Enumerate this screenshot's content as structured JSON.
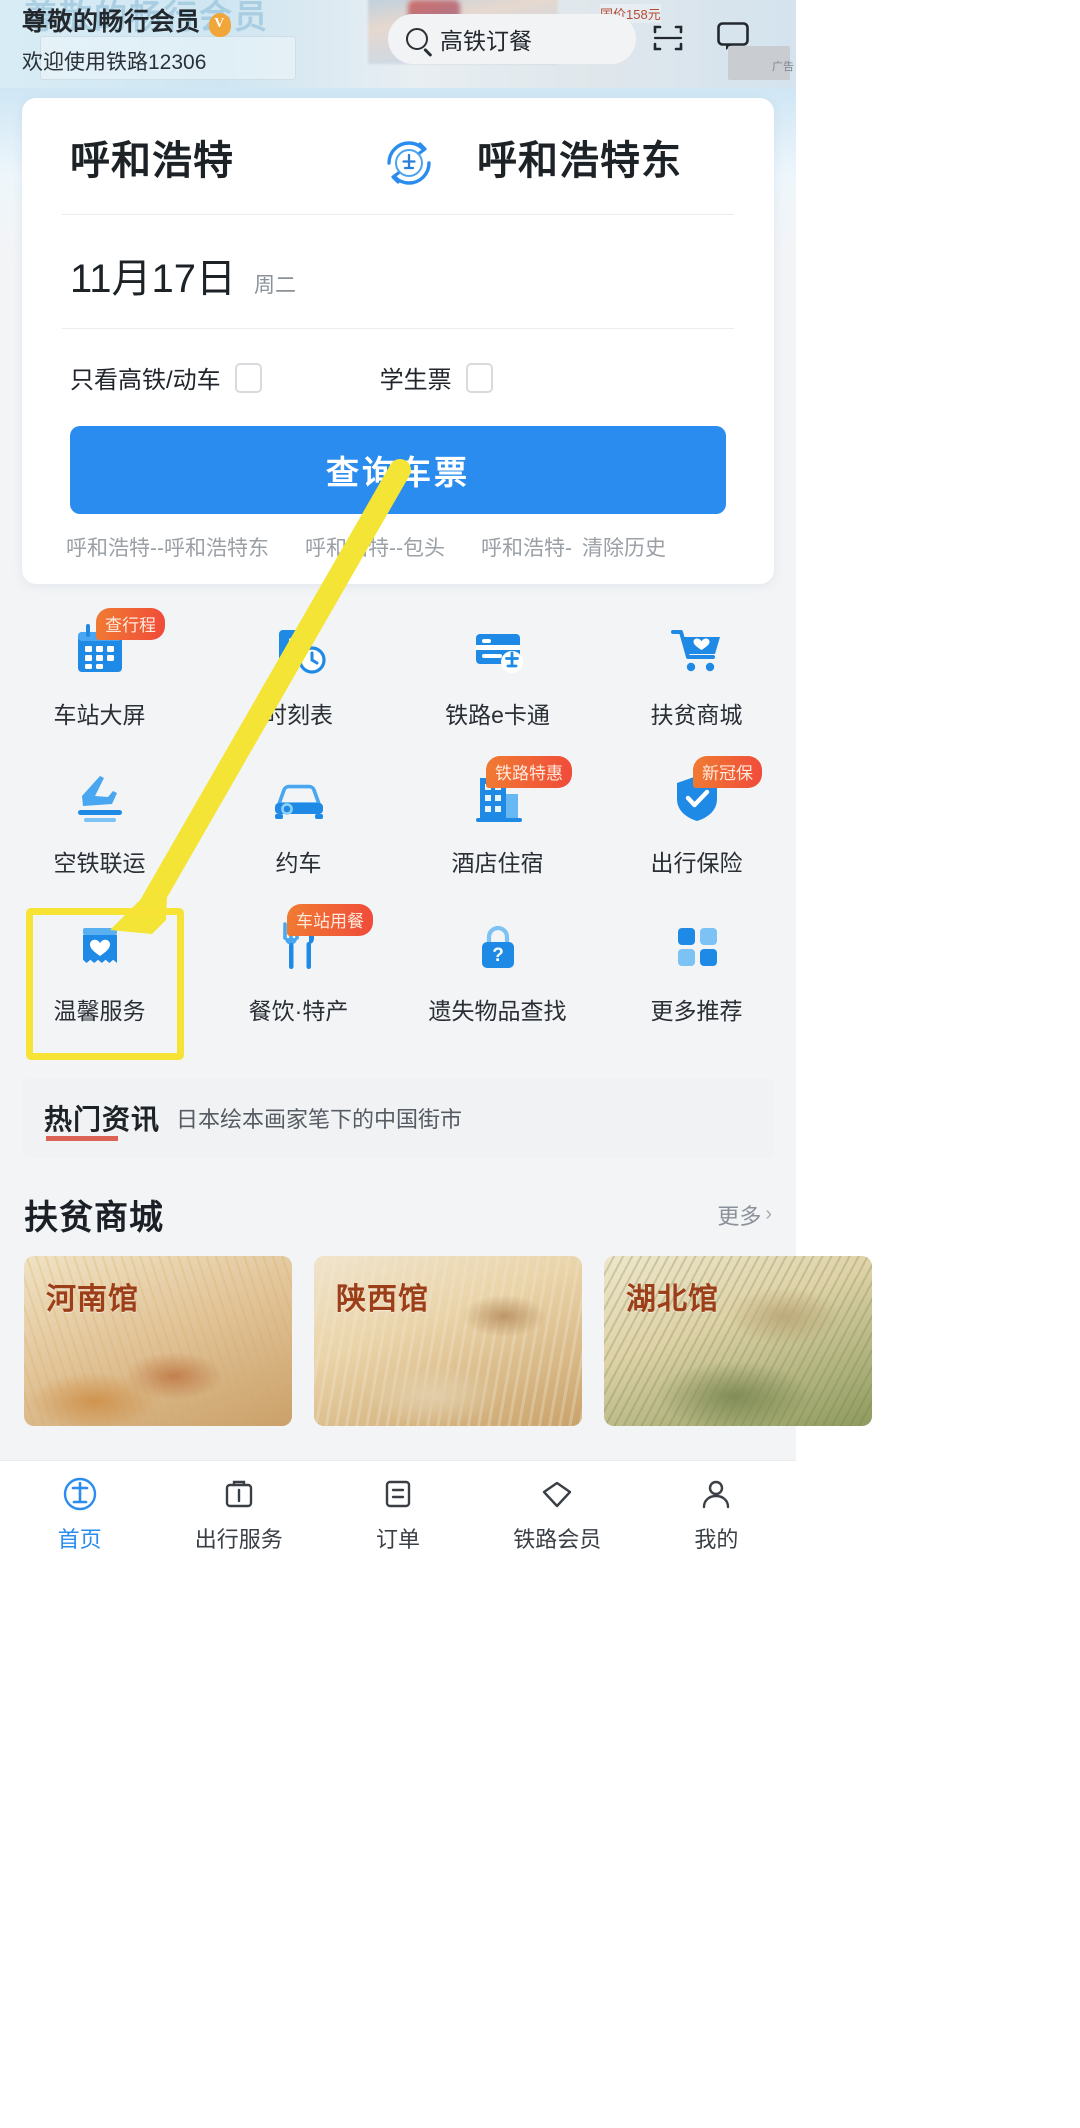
{
  "banner": {
    "ghost_text": "尊敬的畅行会员",
    "greeting": "尊敬的畅行会员",
    "vip_mark": "V",
    "subtitle": "欢迎使用铁路12306",
    "ad_price": "国价158元",
    "ad_label": "广告"
  },
  "search": {
    "placeholder": "高铁订餐",
    "icon": "search-icon",
    "scan_icon": "scan-icon",
    "message_icon": "message-icon"
  },
  "ticket_form": {
    "from_station": "呼和浩特",
    "to_station": "呼和浩特东",
    "swap_icon": "station-swap-icon",
    "date": "11月17日",
    "weekday": "周二",
    "options": [
      {
        "label": "只看高铁/动车",
        "checked": false
      },
      {
        "label": "学生票",
        "checked": false
      }
    ],
    "query_button": "查询车票",
    "history": [
      "呼和浩特--呼和浩特东",
      "呼和浩特--包头",
      "呼和浩特-"
    ],
    "clear_history": "清除历史"
  },
  "grid": [
    {
      "label": "车站大屏",
      "icon": "calendar-screen-icon",
      "badge": "查行程"
    },
    {
      "label": "时刻表",
      "icon": "timetable-clock-icon",
      "badge": ""
    },
    {
      "label": "铁路e卡通",
      "icon": "rail-card-icon",
      "badge": ""
    },
    {
      "label": "扶贫商城",
      "icon": "shopping-cart-icon",
      "badge": ""
    },
    {
      "label": "空铁联运",
      "icon": "air-rail-icon",
      "badge": ""
    },
    {
      "label": "约车",
      "icon": "car-icon",
      "badge": ""
    },
    {
      "label": "酒店住宿",
      "icon": "hotel-building-icon",
      "badge": "铁路特惠"
    },
    {
      "label": "出行保险",
      "icon": "shield-insurance-icon",
      "badge": "新冠保"
    },
    {
      "label": "温馨服务",
      "icon": "warm-service-icon",
      "badge": ""
    },
    {
      "label": "餐饮·特产",
      "icon": "fork-knife-icon",
      "badge": "车站用餐"
    },
    {
      "label": "遗失物品查找",
      "icon": "lost-found-lock-icon",
      "badge": ""
    },
    {
      "label": "更多推荐",
      "icon": "more-grid-icon",
      "badge": ""
    }
  ],
  "news": {
    "tag": "热门资讯",
    "headline": "日本绘本画家笔下的中国街市"
  },
  "mall": {
    "title": "扶贫商城",
    "more": "更多",
    "chevron": "›",
    "cards": [
      {
        "label": "河南馆"
      },
      {
        "label": "陕西馆"
      },
      {
        "label": "湖北馆"
      }
    ]
  },
  "tabbar": [
    {
      "label": "首页",
      "icon": "home-rail-icon",
      "active": true
    },
    {
      "label": "出行服务",
      "icon": "services-icon",
      "active": false
    },
    {
      "label": "订单",
      "icon": "orders-icon",
      "active": false
    },
    {
      "label": "铁路会员",
      "icon": "member-gem-icon",
      "active": false
    },
    {
      "label": "我的",
      "icon": "profile-icon",
      "active": false
    }
  ],
  "annotation": {
    "arrow_color": "#f4e435",
    "highlight_color": "#f6e335",
    "highlight_target": "温馨服务"
  },
  "colors": {
    "primary_blue": "#2b8cf0",
    "icon_blue": "#1e8ae6",
    "badge_orange": "#f07c32",
    "badge_red": "#f04a3a",
    "page_bg": "#f3f4f6"
  }
}
